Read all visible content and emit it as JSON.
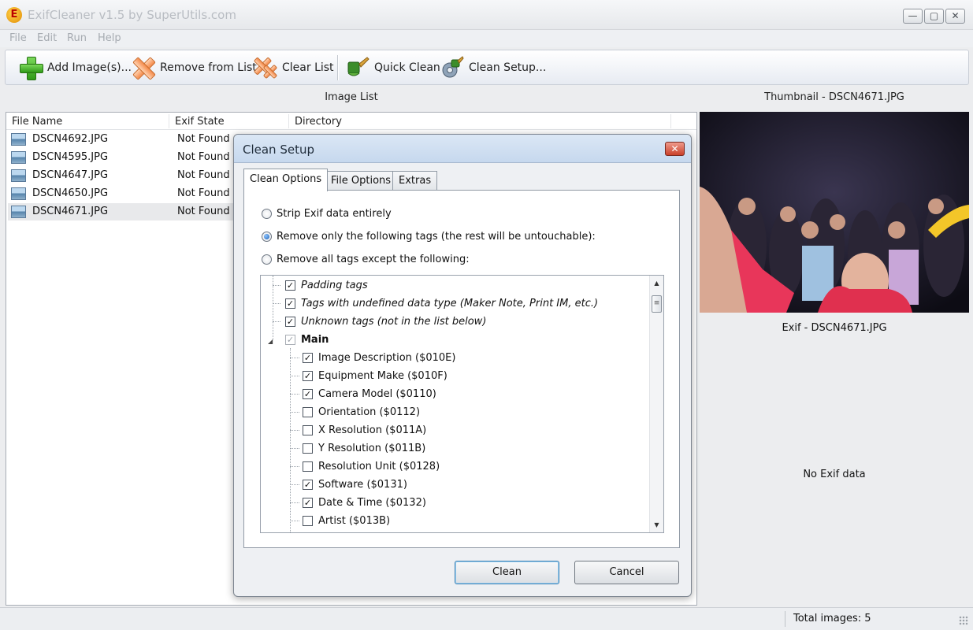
{
  "window": {
    "title": "ExifCleaner v1.5 by SuperUtils.com",
    "app_icon_letter": "E",
    "controls": {
      "minimize": "—",
      "maximize": "▢",
      "close": "✕"
    }
  },
  "menu": {
    "items": [
      "File",
      "Edit",
      "Run",
      "Help"
    ]
  },
  "toolbar": {
    "add_images": "Add Image(s)...",
    "remove_from_list": "Remove from List",
    "clear_list": "Clear List",
    "quick_clean": "Quick Clean",
    "clean_setup": "Clean Setup..."
  },
  "image_list": {
    "header": "Image List",
    "columns": [
      "File Name",
      "Exif State",
      "Directory"
    ],
    "rows": [
      {
        "name": "DSCN4692.JPG",
        "state": "Not Found"
      },
      {
        "name": "DSCN4595.JPG",
        "state": "Not Found"
      },
      {
        "name": "DSCN4647.JPG",
        "state": "Not Found"
      },
      {
        "name": "DSCN4650.JPG",
        "state": "Not Found"
      },
      {
        "name": "DSCN4671.JPG",
        "state": "Not Found"
      }
    ]
  },
  "thumbnail": {
    "header": "Thumbnail - DSCN4671.JPG"
  },
  "exif": {
    "header": "Exif - DSCN4671.JPG",
    "message": "No Exif data"
  },
  "status": {
    "total_images": "Total images: 5"
  },
  "dialog": {
    "title": "Clean Setup",
    "close": "✕",
    "tabs": [
      "Clean Options",
      "File Options",
      "Extras"
    ],
    "radios": [
      {
        "label": "Strip Exif data entirely",
        "selected": false
      },
      {
        "label": "Remove only the following tags (the rest will be untouchable):",
        "selected": true
      },
      {
        "label": "Remove all tags except the following:",
        "selected": false
      }
    ],
    "tree": [
      {
        "label": "Padding tags",
        "checked": true,
        "level": 0,
        "style": "italic"
      },
      {
        "label": "Tags with undefined data type (Maker Note, Print IM, etc.)",
        "checked": true,
        "level": 0,
        "style": "italic"
      },
      {
        "label": "Unknown tags (not in the list below)",
        "checked": true,
        "level": 0,
        "style": "italic"
      },
      {
        "label": "Main",
        "checked": true,
        "level": 0,
        "style": "bold"
      },
      {
        "label": "Image Description ($010E)",
        "checked": true,
        "level": 1,
        "style": ""
      },
      {
        "label": "Equipment Make ($010F)",
        "checked": true,
        "level": 1,
        "style": ""
      },
      {
        "label": "Camera Model ($0110)",
        "checked": true,
        "level": 1,
        "style": ""
      },
      {
        "label": "Orientation ($0112)",
        "checked": false,
        "level": 1,
        "style": ""
      },
      {
        "label": "X Resolution ($011A)",
        "checked": false,
        "level": 1,
        "style": ""
      },
      {
        "label": "Y Resolution ($011B)",
        "checked": false,
        "level": 1,
        "style": ""
      },
      {
        "label": "Resolution Unit ($0128)",
        "checked": false,
        "level": 1,
        "style": ""
      },
      {
        "label": "Software ($0131)",
        "checked": true,
        "level": 1,
        "style": ""
      },
      {
        "label": "Date & Time ($0132)",
        "checked": true,
        "level": 1,
        "style": ""
      },
      {
        "label": "Artist ($013B)",
        "checked": false,
        "level": 1,
        "style": ""
      }
    ],
    "buttons": {
      "clean": "Clean",
      "cancel": "Cancel"
    }
  }
}
